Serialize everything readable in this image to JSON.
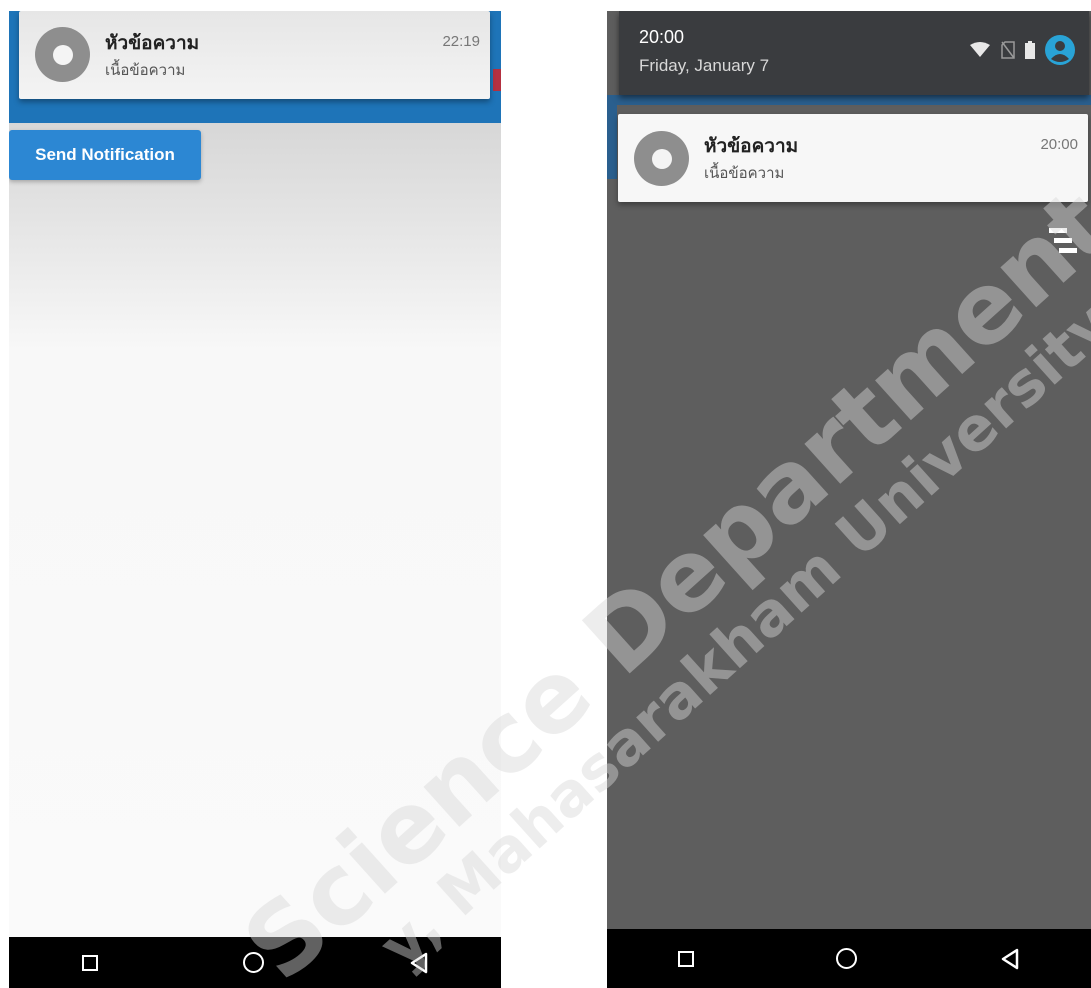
{
  "left_screen": {
    "notification": {
      "title": "หัวข้อความ",
      "body": "เนื้อข้อความ",
      "time": "22:19",
      "icon": "app-circle-icon"
    },
    "send_button_label": "Send Notification",
    "nav": {
      "icons": [
        "recents-square-icon",
        "home-circle-icon",
        "back-triangle-icon"
      ]
    }
  },
  "right_screen": {
    "status": {
      "time": "20:00",
      "date": "Friday, January 7",
      "icons": [
        "wifi-icon",
        "no-sim-icon",
        "battery-icon",
        "account-icon"
      ]
    },
    "notification": {
      "title": "หัวข้อความ",
      "body": "เนื้อข้อความ",
      "time": "20:00",
      "icon": "app-circle-icon"
    },
    "clear_all_icon": "clear-all-icon",
    "nav": {
      "icons": [
        "recents-square-icon",
        "home-circle-icon",
        "back-triangle-icon"
      ]
    }
  },
  "watermark": {
    "line1": "Science Department",
    "line2": "y, Mahasarakham University"
  },
  "colors": {
    "app_blue": "#1e74b8",
    "button_blue": "#2c87d3",
    "shade_gray": "#5e5e5e",
    "account_teal": "#29a3d6"
  }
}
